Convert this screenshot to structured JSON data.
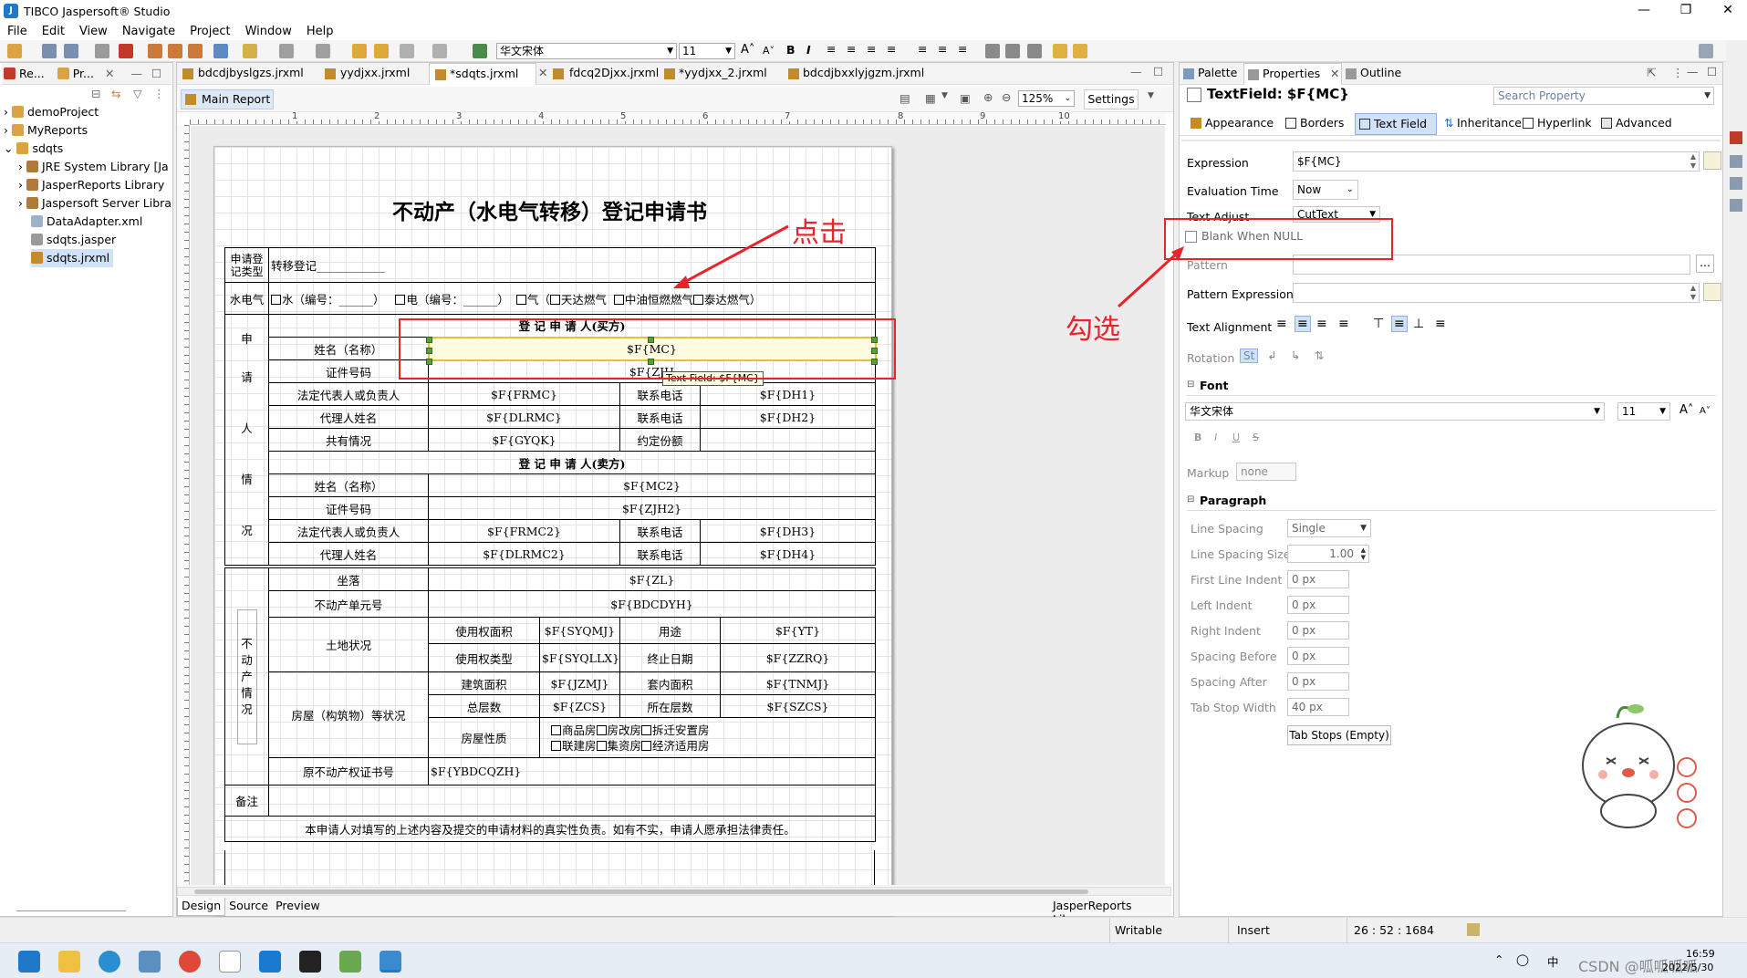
{
  "window": {
    "title": "TIBCO Jaspersoft® Studio"
  },
  "menu": [
    "File",
    "Edit",
    "View",
    "Navigate",
    "Project",
    "Window",
    "Help"
  ],
  "toolbar": {
    "font_name": "华文宋体",
    "font_size": "11"
  },
  "left_panel": {
    "tabs": [
      "Re...",
      "Pr..."
    ],
    "tree": [
      "demoProject",
      "MyReports",
      "sdqts",
      "JRE System Library [Ja",
      "JasperReports Library",
      "Jaspersoft Server Libra",
      "DataAdapter.xml",
      "sdqts.jasper",
      "sdqts.jrxml"
    ]
  },
  "editor": {
    "tabs": [
      "bdcdjbyslgzs.jrxml",
      "yydjxx.jrxml",
      "*sdqts.jrxml",
      "fdcq2Djxx.jrxml",
      "*yydjxx_2.jrxml",
      "bdcdjbxxlyjgzm.jrxml"
    ],
    "sub_tab": "Main Report",
    "zoom": "125%",
    "settings": "Settings",
    "bottom_tabs": [
      "Design",
      "Source",
      "Preview"
    ],
    "library": "JasperReports Library",
    "ruler_numbers": [
      "1",
      "2",
      "3",
      "4",
      "5",
      "6",
      "7",
      "8",
      "9",
      "10"
    ],
    "tooltip": "Text Field: $F{MC}"
  },
  "report": {
    "title": "不动产（水电气转移）登记申请书",
    "reg_type_label": "申请登记类型",
    "reg_type_value": "转移登记____________",
    "utility_label": "水电气",
    "water": "水（编号：______）",
    "electric": "电（编号：______）",
    "gas": "气（",
    "gas1": "天达燃气",
    "gas2": "中油恒燃燃气",
    "gas3": "泰达燃气）",
    "applicant_side": [
      "申",
      "请",
      "人",
      "情",
      "况"
    ],
    "buyer_header": "登 记 申 请 人(买方)",
    "seller_header": "登 记 申 请 人(卖方)",
    "name": "姓名（名称）",
    "id_no": "证件号码",
    "legal_rep": "法定代表人或负责人",
    "agent": "代理人姓名",
    "phone": "联系电话",
    "shared": "共有情况",
    "share_agreed": "约定份额",
    "f_mc": "$F{MC}",
    "f_zjh": "$F{ZJH",
    "f_frmc": "$F{FRMC}",
    "f_dh1": "$F{DH1}",
    "f_dlrmc": "$F{DLRMC}",
    "f_dh2": "$F{DH2}",
    "f_gyqk": "$F{GYQK}",
    "f_mc2": "$F{MC2}",
    "f_zjh2": "$F{ZJH2}",
    "f_frmc2": "$F{FRMC2}",
    "f_dh3": "$F{DH3}",
    "f_dlrmc2": "$F{DLRMC2}",
    "f_dh4": "$F{DH4}",
    "property_side": "不动产情况",
    "location": "坐落",
    "f_zl": "$F{ZL}",
    "unit_no": "不动产单元号",
    "f_bdcdyh": "$F{BDCDYH}",
    "land": "土地状况",
    "use_area": "使用权面积",
    "f_syqmj": "$F{SYQMJ}",
    "use": "用途",
    "f_yt": "$F{YT}",
    "use_type": "使用权类型",
    "f_syqllx": "$F{SYQLLX}",
    "end_date": "终止日期",
    "f_zzrq": "$F{ZZRQ}",
    "building": "房屋（构筑物）等状况",
    "build_area": "建筑面积",
    "f_jzmj": "$F{JZMJ}",
    "inner_area": "套内面积",
    "f_tnmj": "$F{TNMJ}",
    "total_floors": "总层数",
    "f_zcs": "$F{ZCS}",
    "floor": "所在层数",
    "f_szcs": "$F{SZCS}",
    "house_nature": "房屋性质",
    "nature_r1": [
      "商品房",
      "房改房",
      "拆迁安置房"
    ],
    "nature_r2": [
      "联建房",
      "集资房",
      "经济适用房"
    ],
    "orig_cert": "原不动产权证书号",
    "f_ybdcqzh": "$F{YBDCQZH}",
    "remark": "备注",
    "declaration": "本申请人对填写的上述内容及提交的申请材料的真实性负责。如有不实，申请人愿承担法律责任。"
  },
  "right_panel": {
    "tabs": [
      "Palette",
      "Properties",
      "Outline"
    ],
    "header": "TextField: $F{MC}",
    "search_placeholder": "Search Property",
    "subtabs": [
      "Appearance",
      "Borders",
      "Text Field",
      "Inheritance",
      "Hyperlink",
      "Advanced"
    ],
    "expression_label": "Expression",
    "expression_value": "$F{MC}",
    "eval_time_label": "Evaluation Time",
    "eval_time_value": "Now",
    "text_adjust_label": "Text Adjust",
    "text_adjust_value": "CutText",
    "blank_when_null": "Blank When NULL",
    "pattern_label": "Pattern",
    "pattern_expr_label": "Pattern Expression",
    "text_align_label": "Text Alignment",
    "rotation_label": "Rotation",
    "font_section": "Font",
    "font_name": "华文宋体",
    "font_size": "11",
    "markup_label": "Markup",
    "markup_value": "none",
    "paragraph_section": "Paragraph",
    "line_spacing_label": "Line Spacing",
    "line_spacing_value": "Single",
    "line_spacing_size_label": "Line Spacing Size",
    "line_spacing_size_value": "1.00",
    "first_line_indent_label": "First Line Indent",
    "left_indent_label": "Left Indent",
    "right_indent_label": "Right Indent",
    "spacing_before_label": "Spacing Before",
    "spacing_after_label": "Spacing After",
    "tab_stop_width_label": "Tab Stop Width",
    "px0": "0 px",
    "px40": "40 px",
    "tab_stops_button": "Tab Stops (Empty)"
  },
  "annotations": {
    "click": "点击",
    "check": "勾选"
  },
  "status": {
    "writable": "Writable",
    "insert": "Insert",
    "position": "26 : 52 : 1684"
  },
  "taskbar": {
    "time": "16:59",
    "date": "2022/5/30",
    "watermark": "CSDN @呱呱呱呱"
  }
}
